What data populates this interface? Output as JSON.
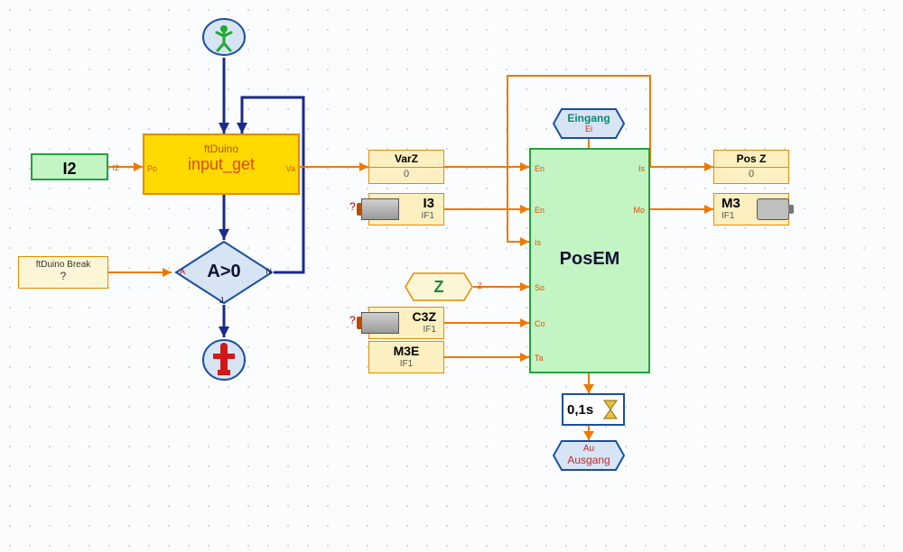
{
  "start": {
    "title": "Start"
  },
  "stop": {
    "title": "Stop"
  },
  "I2": {
    "label": "I2",
    "port_out": "I2",
    "port_in": "Po"
  },
  "ftduino_break": {
    "line1": "ftDuino Break",
    "line2": "?"
  },
  "input_get": {
    "line1": "ftDuino",
    "line2": "input_get",
    "port_in": "Po",
    "port_out": "Va"
  },
  "decision": {
    "expr": "A>0",
    "pA": "A",
    "pN": "N",
    "pJ": "J"
  },
  "VarZ": {
    "header": "VarZ",
    "value": "0"
  },
  "I3": {
    "label": "I3",
    "sub": "IF1"
  },
  "Z": {
    "label": "Z",
    "port": "Z"
  },
  "C3Z": {
    "label": "C3Z",
    "sub": "IF1"
  },
  "M3E": {
    "label": "M3E",
    "sub": "IF1"
  },
  "Eingang": {
    "t1": "Eingang",
    "t2": "Ei"
  },
  "Ausgang": {
    "t1": "Au",
    "t2": "Ausgang"
  },
  "PosEM": {
    "title": "PosEM",
    "ports_left": [
      "En",
      "En",
      "Is",
      "So",
      "Co",
      "Ta"
    ],
    "ports_right": [
      "Is",
      "Mo"
    ]
  },
  "PosZ": {
    "header": "Pos Z",
    "value": "0"
  },
  "M3": {
    "label": "M3",
    "sub": "IF1"
  },
  "timer": {
    "text": "0,1s"
  }
}
